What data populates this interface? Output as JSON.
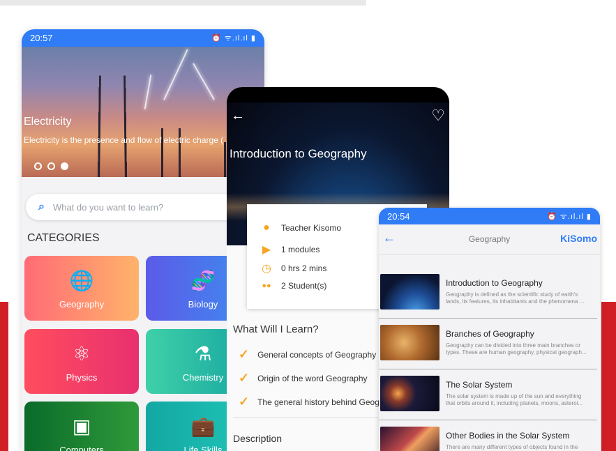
{
  "phone1": {
    "time": "20:57",
    "status_icons": "⏰ ᯤ.ıl.ıl ▮",
    "hero": {
      "title": "Electricity",
      "subtitle": "Electricity is the presence and flow of electric charge ("
    },
    "search": {
      "placeholder": "What do you want to learn?"
    },
    "categories_title": "CATEGORIES",
    "categories": [
      {
        "label": "Geography",
        "icon": "globe-icon",
        "glyph": "🌐",
        "gradient": [
          "#ff6b75",
          "#ffb36b"
        ]
      },
      {
        "label": "Biology",
        "icon": "dna-icon",
        "glyph": "🧬",
        "gradient": [
          "#5b5be8",
          "#3d8ff0"
        ]
      },
      {
        "label": "Physics",
        "icon": "atom-icon",
        "glyph": "⚛",
        "gradient": [
          "#ff4d5e",
          "#e8306f"
        ]
      },
      {
        "label": "Chemistry",
        "icon": "flask-icon",
        "glyph": "⚗",
        "gradient": [
          "#3fd0a8",
          "#14a3a0"
        ]
      },
      {
        "label": "Computers",
        "icon": "chip-icon",
        "glyph": "▣",
        "gradient": [
          "#0a6b2a",
          "#2f9a3a"
        ]
      },
      {
        "label": "Life Skills",
        "icon": "briefcase-icon",
        "glyph": "💼",
        "gradient": [
          "#13a7a3",
          "#21c7b8"
        ]
      }
    ]
  },
  "phone2": {
    "title": "Introduction to Geography",
    "card": [
      {
        "icon": "person-icon",
        "glyph": "●",
        "text": "Teacher Kisomo"
      },
      {
        "icon": "play-icon",
        "glyph": "▶",
        "text": "1 modules"
      },
      {
        "icon": "clock-icon",
        "glyph": "◷",
        "text": "0 hrs 2 mins"
      },
      {
        "icon": "people-icon",
        "glyph": "●●",
        "text": "2 Student(s)"
      }
    ],
    "learn_title": "What Will I Learn?",
    "learn_items": [
      "General concepts of Geography",
      "Origin of the word Geography",
      "The general history behind Geogra"
    ],
    "description_title": "Description"
  },
  "phone3": {
    "time": "20:54",
    "status_icons": "⏰ ᯤ.ıl.ıl ▮",
    "title": "Geography",
    "logo": "KiSomo",
    "items": [
      {
        "title": "Introduction to Geography",
        "desc1": "Geography is defined as the scientific study of earth's",
        "desc2": "lands, its features, its inhabitants and the phenomena ..."
      },
      {
        "title": "Branches of Geography",
        "desc1": "Geography can be divided into three main branches or",
        "desc2": "types. These are human geography, physical geograph..."
      },
      {
        "title": "The Solar System",
        "desc1": "The solar system is made up of the sun and everything",
        "desc2": "that orbits around it, including planets, moons, asteroi..."
      },
      {
        "title": "Other Bodies in the Solar System",
        "desc1": "There are many different types of objects found in the",
        "desc2": ""
      }
    ]
  }
}
